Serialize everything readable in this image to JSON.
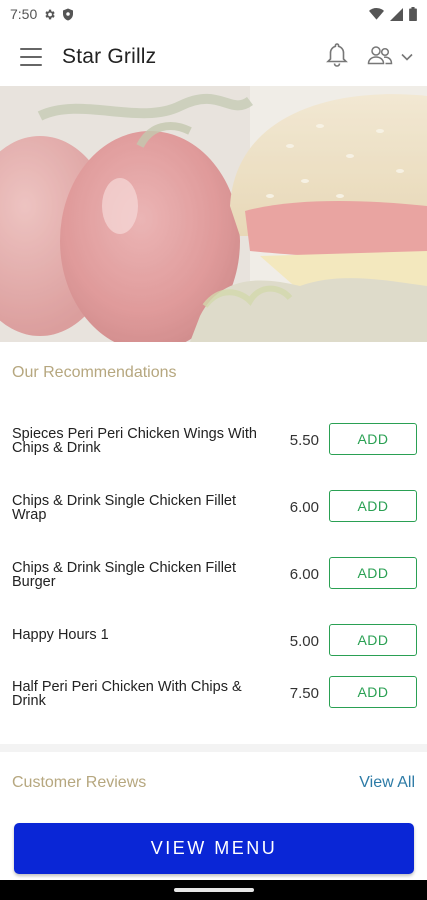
{
  "status_bar": {
    "time": "7:50"
  },
  "header": {
    "title": "Star Grillz"
  },
  "recommendations": {
    "title": "Our Recommendations",
    "items": [
      {
        "name": "Spieces Peri Peri Chicken Wings With Chips & Drink",
        "price": "5.50",
        "button": "ADD"
      },
      {
        "name": "Chips & Drink Single Chicken Fillet Wrap",
        "price": "6.00",
        "button": "ADD"
      },
      {
        "name": "Chips & Drink Single Chicken Fillet Burger",
        "price": "6.00",
        "button": "ADD"
      },
      {
        "name": "Happy Hours 1",
        "price": "5.00",
        "button": "ADD"
      },
      {
        "name": "Half Peri Peri Chicken With Chips & Drink",
        "price": "7.50",
        "button": "ADD"
      }
    ]
  },
  "reviews": {
    "title": "Customer Reviews",
    "view_all": "View All"
  },
  "footer": {
    "view_menu": "VIEW MENU"
  },
  "colors": {
    "accent_gold": "#b6a77f",
    "add_green": "#2aa053",
    "primary_blue": "#0a26d6",
    "link_blue": "#2d7ba6"
  },
  "icons": [
    "settings-icon",
    "shield-icon",
    "wifi-icon",
    "signal-icon",
    "battery-icon",
    "menu-icon",
    "bell-icon",
    "user-group-icon",
    "chevron-down-icon"
  ]
}
